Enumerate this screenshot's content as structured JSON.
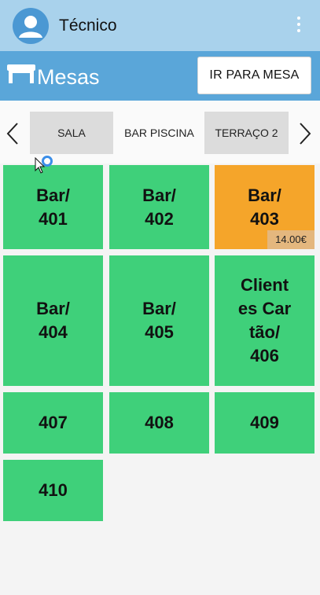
{
  "topbar": {
    "user_name": "Técnico",
    "avatar_icon": "user-avatar-icon",
    "menu_icon": "more-vert-icon",
    "background": "#a9d2ec"
  },
  "header": {
    "section_icon": "table-icon",
    "title": "Mesas",
    "goto_button": "IR PARA MESA",
    "background": "#5aa6d9"
  },
  "tabs": [
    {
      "label": "SALA",
      "active": false
    },
    {
      "label": "BAR PISCINA",
      "active": true
    },
    {
      "label": "TERRAÇO 2",
      "active": false
    }
  ],
  "colors": {
    "free": "#3fd07a",
    "occupied": "#f5a52a",
    "amount_bg": "#e4b77e"
  },
  "tables": [
    {
      "label": "Bar/\n401",
      "status": "free"
    },
    {
      "label": "Bar/\n402",
      "status": "free"
    },
    {
      "label": "Bar/\n403",
      "status": "occupied",
      "amount": "14.00€"
    },
    {
      "label": "Bar/\n404",
      "status": "free"
    },
    {
      "label": "Bar/\n405",
      "status": "free"
    },
    {
      "label": "Client\nes Car\ntão/\n406",
      "status": "free"
    },
    {
      "label": "407",
      "status": "free"
    },
    {
      "label": "408",
      "status": "free"
    },
    {
      "label": "409",
      "status": "free"
    },
    {
      "label": "410",
      "status": "free"
    }
  ]
}
